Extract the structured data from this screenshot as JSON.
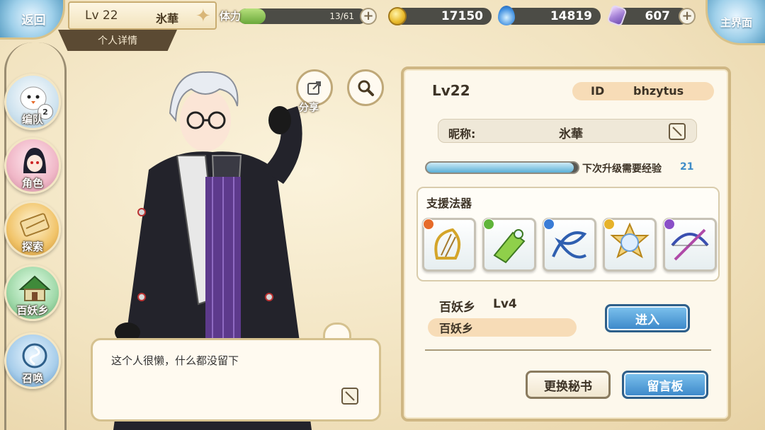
{
  "header": {
    "back_label": "返回",
    "home_label": "主界面",
    "player_level": "Lv 22",
    "player_name": "氷華",
    "detail_tab": "个人详情",
    "stamina": {
      "label": "体力",
      "text": "13/61",
      "current": 13,
      "max": 61
    },
    "coins": "17150",
    "spirit": "14819",
    "gems": "607"
  },
  "menu": [
    {
      "id": "team",
      "label": "编队",
      "badge": "2"
    },
    {
      "id": "character",
      "label": "角色"
    },
    {
      "id": "explore",
      "label": "探索"
    },
    {
      "id": "village",
      "label": "百妖乡"
    },
    {
      "id": "summon",
      "label": "召唤"
    }
  ],
  "character": {
    "share_label": "分享",
    "message": "这个人很懒，什么都没留下"
  },
  "profile": {
    "level": "Lv22",
    "id_label": "ID",
    "id_value": "bhzytus",
    "nickname_label": "昵称:",
    "nickname": "氷華",
    "exp_label": "下次升级需要经验",
    "exp_value": "21",
    "exp_progress": 0.97,
    "support_title": "支援法器",
    "artifacts": [
      {
        "element_color": "#e66b2a"
      },
      {
        "element_color": "#5fb43a"
      },
      {
        "element_color": "#3a7cd6"
      },
      {
        "element_color": "#e6b22a"
      },
      {
        "element_color": "#8a4fc8"
      }
    ],
    "village_name": "百妖乡",
    "village_level": "Lv4",
    "village_pill": "百妖乡",
    "enter_label": "进入",
    "change_secretary_label": "更换秘书",
    "message_board_label": "留言板"
  },
  "colors": {
    "accent_blue": "#3a86c8",
    "panel_bg": "#fdf8ec",
    "pill_bg": "#f7dcb7"
  }
}
